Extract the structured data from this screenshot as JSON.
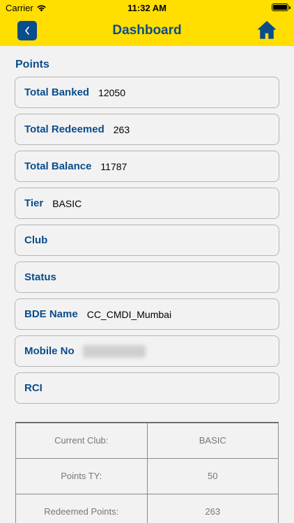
{
  "status_bar": {
    "carrier": "Carrier",
    "time": "11:32 AM"
  },
  "nav": {
    "title": "Dashboard",
    "back_icon": "chevron-left-icon",
    "home_icon": "home-icon"
  },
  "colors": {
    "header_bg": "#ffde00",
    "brand_blue": "#0a4d8c"
  },
  "points": {
    "section_title": "Points",
    "fields": [
      {
        "label": "Total Banked",
        "value": "12050"
      },
      {
        "label": "Total Redeemed",
        "value": "263"
      },
      {
        "label": "Total Balance",
        "value": "11787"
      },
      {
        "label": "Tier",
        "value": "BASIC"
      },
      {
        "label": "Club",
        "value": ""
      },
      {
        "label": "Status",
        "value": ""
      },
      {
        "label": "BDE Name",
        "value": "CC_CMDI_Mumbai"
      },
      {
        "label": "Mobile No",
        "value": ""
      },
      {
        "label": "RCI",
        "value": ""
      }
    ]
  },
  "summary_table": {
    "rows": [
      {
        "label": "Current Club:",
        "value": "BASIC"
      },
      {
        "label": "Points TY:",
        "value": "50"
      },
      {
        "label": "Redeemed Points:",
        "value": "263"
      }
    ]
  }
}
